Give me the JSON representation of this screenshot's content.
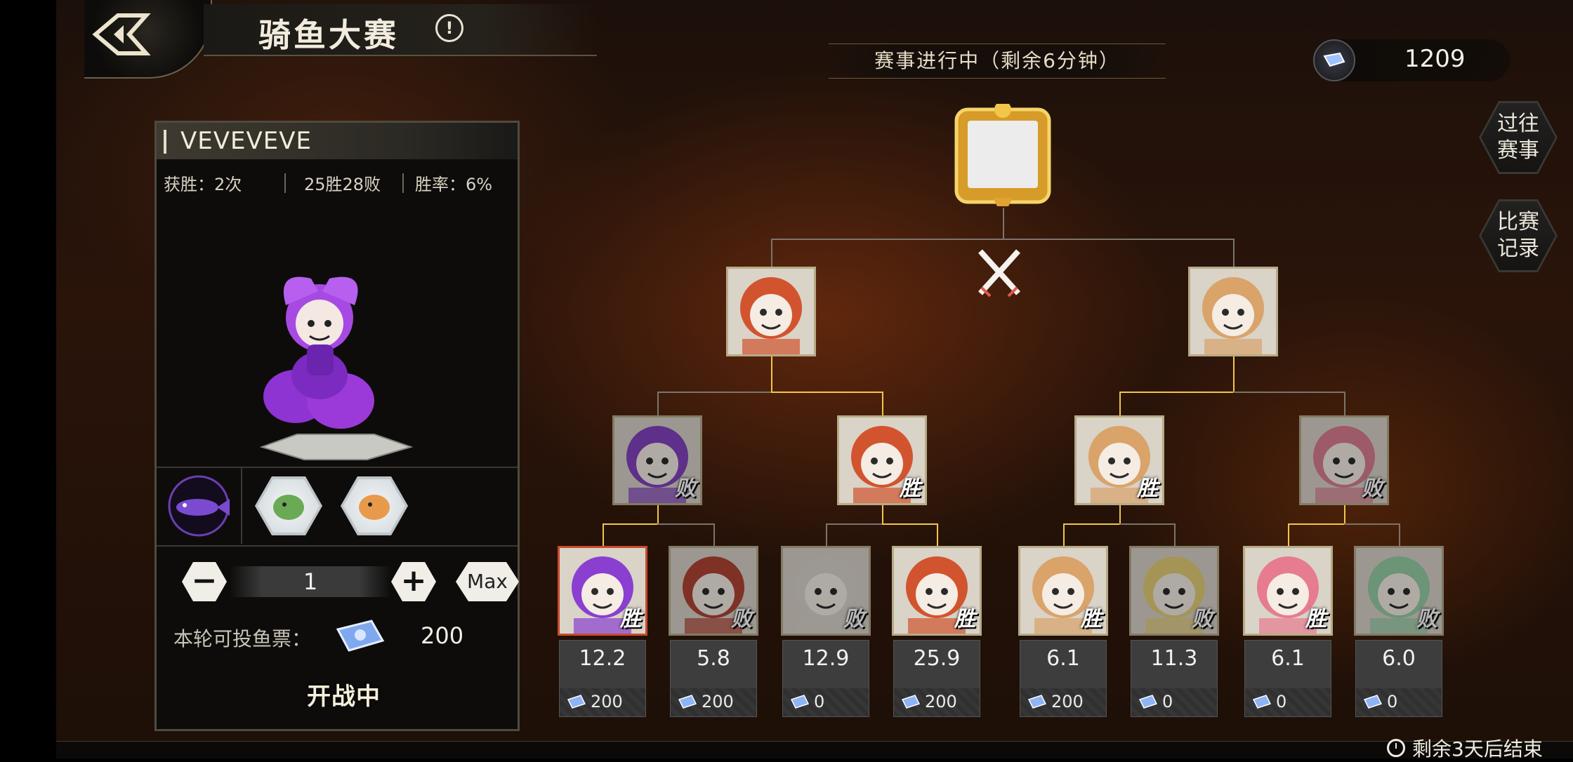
{
  "header": {
    "title": "骑鱼大赛",
    "info_icon": "!",
    "status": "赛事进行中（剩余6分钟）",
    "currency_value": "1209"
  },
  "side_buttons": {
    "past_events": "过往\n赛事",
    "match_records": "比赛\n记录"
  },
  "footer": {
    "remaining": "剩余3天后结束"
  },
  "player": {
    "name": "VEVEVEVE",
    "wins_label": "获胜：2次",
    "record": "25胜28败",
    "win_rate": "胜率：6%"
  },
  "bet": {
    "quantity": "1",
    "minus": "−",
    "plus": "+",
    "max_label": "Max",
    "ticket_label": "本轮可投鱼票：",
    "ticket_value": "200",
    "status": "开战中"
  },
  "bracket": {
    "round1": [
      {
        "result": "胜",
        "odds": "12.2",
        "bet": "200",
        "hair": "#8a3fd0"
      },
      {
        "result": "败",
        "odds": "5.8",
        "bet": "200",
        "hair": "#c0402f"
      },
      {
        "result": "败",
        "odds": "12.9",
        "bet": "0",
        "hair": "#d9d5cc"
      },
      {
        "result": "胜",
        "odds": "25.9",
        "bet": "200",
        "hair": "#d2542e"
      },
      {
        "result": "胜",
        "odds": "6.1",
        "bet": "200",
        "hair": "#d9a36a"
      },
      {
        "result": "败",
        "odds": "11.3",
        "bet": "0",
        "hair": "#e8cf6a"
      },
      {
        "result": "胜",
        "odds": "6.1",
        "bet": "0",
        "hair": "#e77b8f"
      },
      {
        "result": "败",
        "odds": "6.0",
        "bet": "0",
        "hair": "#8fd0a0"
      }
    ],
    "round2": [
      {
        "result": "败",
        "hair": "#8a3fd0"
      },
      {
        "result": "胜",
        "hair": "#d2542e"
      },
      {
        "result": "胜",
        "hair": "#d9a36a"
      },
      {
        "result": "败",
        "hair": "#e77b8f"
      }
    ],
    "round3": [
      {
        "result": "",
        "hair": "#d2542e"
      },
      {
        "result": "",
        "hair": "#d9a36a"
      }
    ]
  },
  "icons": [
    "back-icon",
    "info-icon",
    "fish-ticket-icon",
    "trophy-icon",
    "crossed-swords-icon",
    "clock-icon"
  ]
}
